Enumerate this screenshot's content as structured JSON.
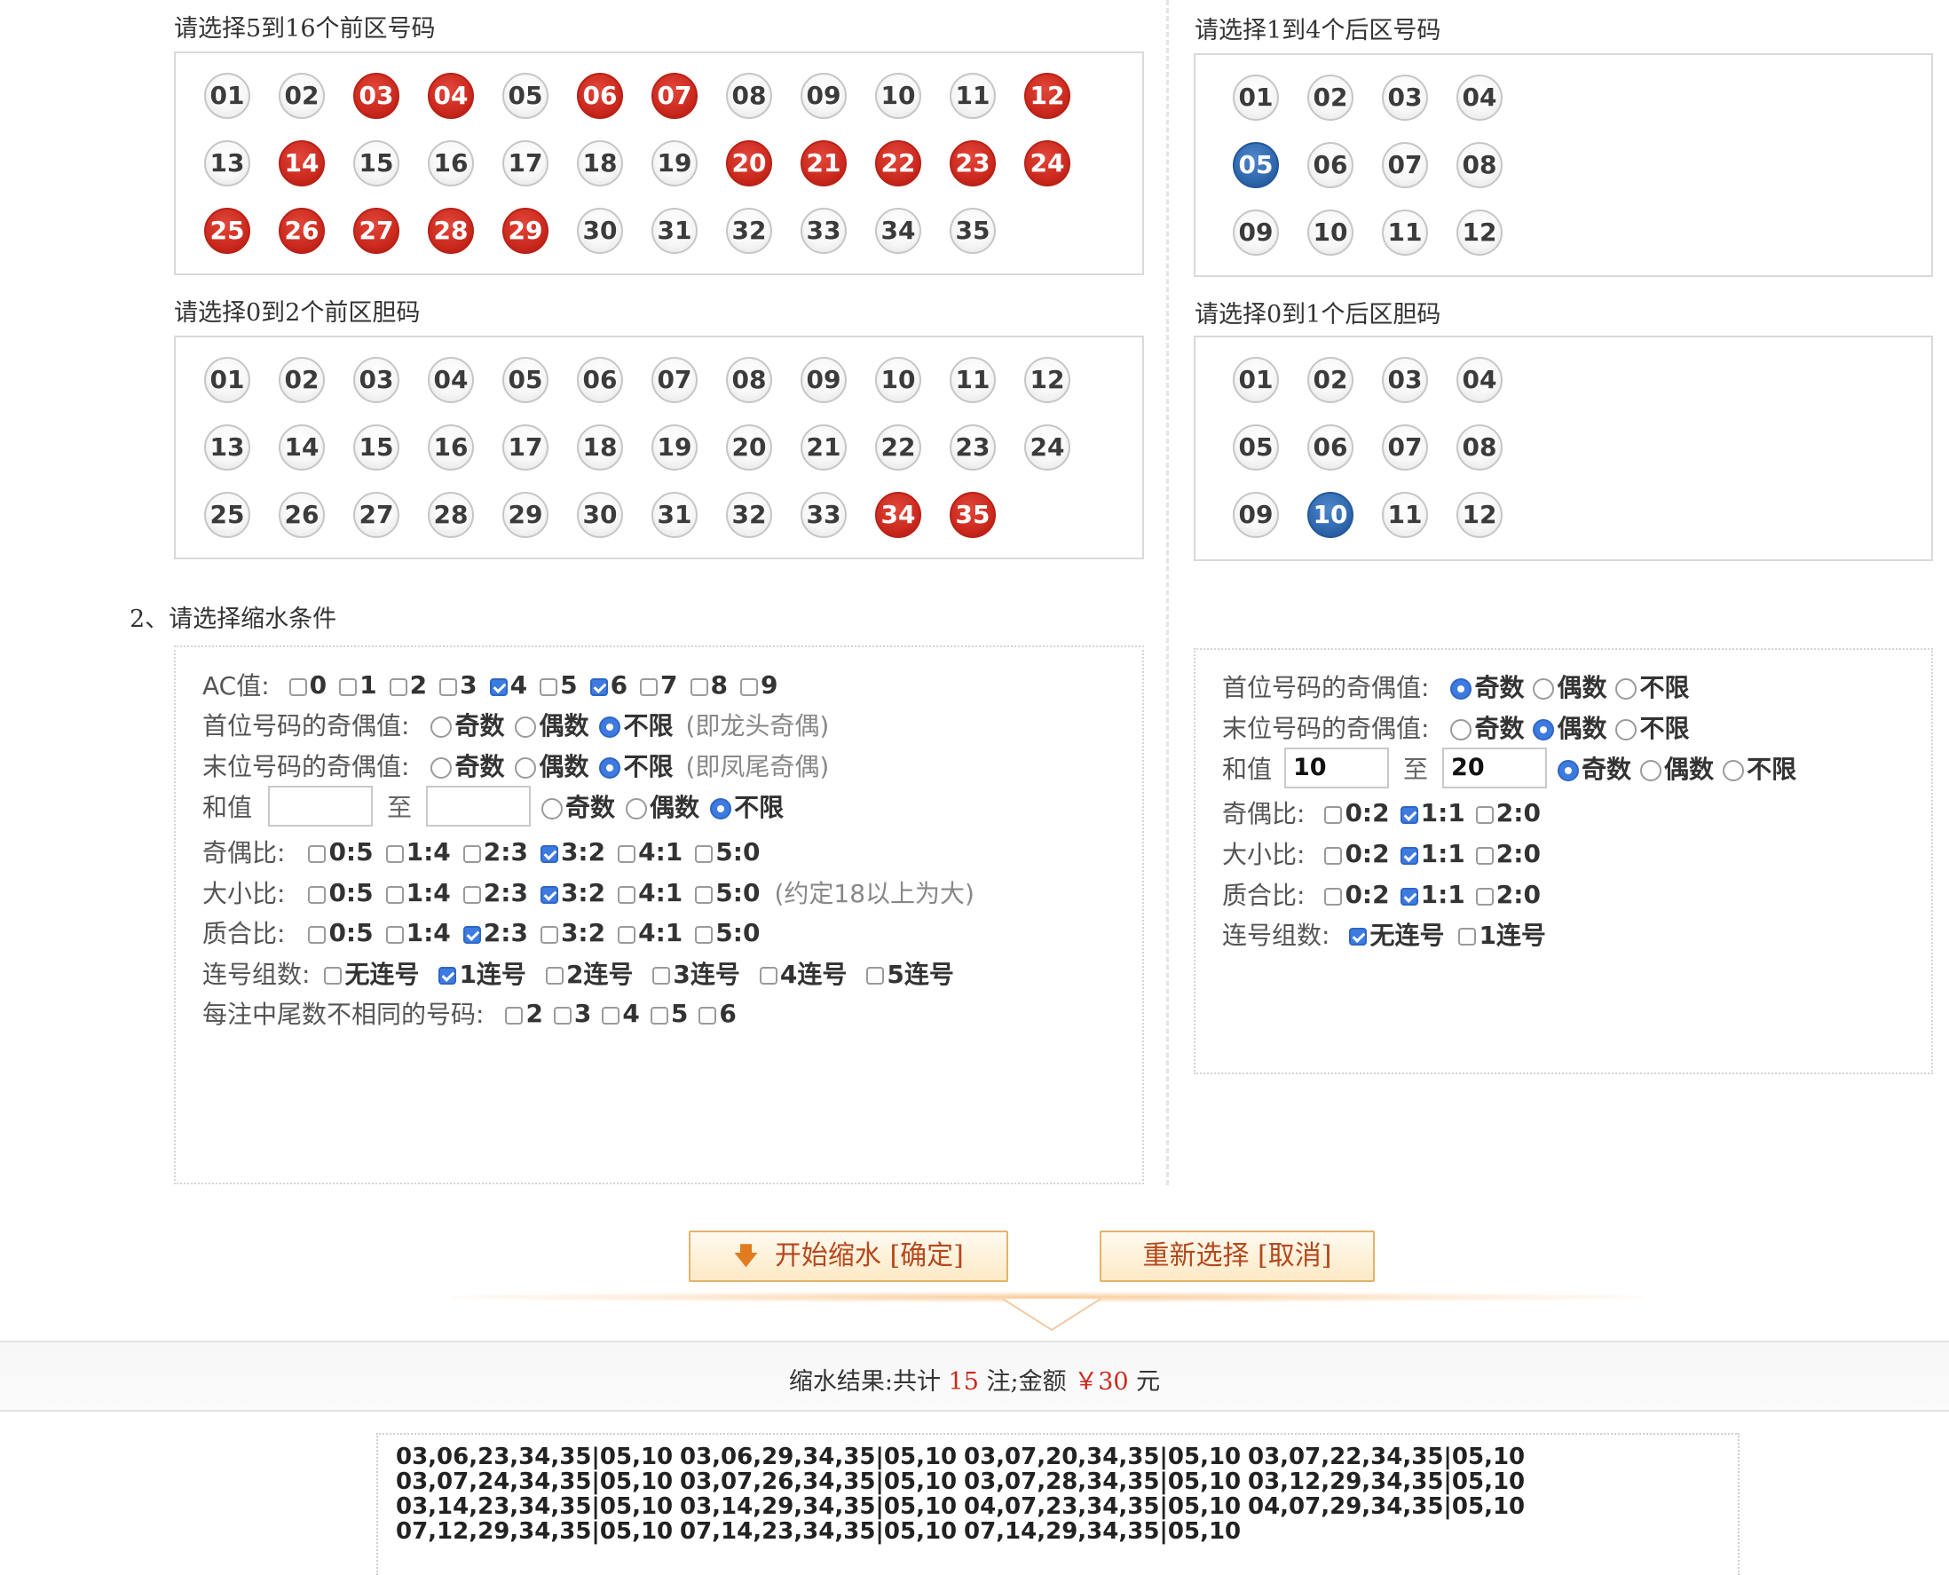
{
  "sections": {
    "front_main_label": "请选择5到16个前区号码",
    "back_main_label": "请选择1到4个后区号码",
    "front_dan_label": "请选择0到2个前区胆码",
    "back_dan_label": "请选择0到1个后区胆码",
    "conditions_label": "2、请选择缩水条件"
  },
  "front_main": [
    {
      "n": "01",
      "s": "off"
    },
    {
      "n": "02",
      "s": "off"
    },
    {
      "n": "03",
      "s": "red"
    },
    {
      "n": "04",
      "s": "red"
    },
    {
      "n": "05",
      "s": "off"
    },
    {
      "n": "06",
      "s": "red"
    },
    {
      "n": "07",
      "s": "red"
    },
    {
      "n": "08",
      "s": "off"
    },
    {
      "n": "09",
      "s": "off"
    },
    {
      "n": "10",
      "s": "off"
    },
    {
      "n": "11",
      "s": "off"
    },
    {
      "n": "12",
      "s": "red"
    },
    {
      "n": "13",
      "s": "off"
    },
    {
      "n": "14",
      "s": "red"
    },
    {
      "n": "15",
      "s": "off"
    },
    {
      "n": "16",
      "s": "off"
    },
    {
      "n": "17",
      "s": "off"
    },
    {
      "n": "18",
      "s": "off"
    },
    {
      "n": "19",
      "s": "off"
    },
    {
      "n": "20",
      "s": "red"
    },
    {
      "n": "21",
      "s": "red"
    },
    {
      "n": "22",
      "s": "red"
    },
    {
      "n": "23",
      "s": "red"
    },
    {
      "n": "24",
      "s": "red"
    },
    {
      "n": "25",
      "s": "red"
    },
    {
      "n": "26",
      "s": "red"
    },
    {
      "n": "27",
      "s": "red"
    },
    {
      "n": "28",
      "s": "red"
    },
    {
      "n": "29",
      "s": "red"
    },
    {
      "n": "30",
      "s": "off"
    },
    {
      "n": "31",
      "s": "off"
    },
    {
      "n": "32",
      "s": "off"
    },
    {
      "n": "33",
      "s": "off"
    },
    {
      "n": "34",
      "s": "off"
    },
    {
      "n": "35",
      "s": "off"
    }
  ],
  "front_dan": [
    {
      "n": "01",
      "s": "off"
    },
    {
      "n": "02",
      "s": "off"
    },
    {
      "n": "03",
      "s": "off"
    },
    {
      "n": "04",
      "s": "off"
    },
    {
      "n": "05",
      "s": "off"
    },
    {
      "n": "06",
      "s": "off"
    },
    {
      "n": "07",
      "s": "off"
    },
    {
      "n": "08",
      "s": "off"
    },
    {
      "n": "09",
      "s": "off"
    },
    {
      "n": "10",
      "s": "off"
    },
    {
      "n": "11",
      "s": "off"
    },
    {
      "n": "12",
      "s": "off"
    },
    {
      "n": "13",
      "s": "off"
    },
    {
      "n": "14",
      "s": "off"
    },
    {
      "n": "15",
      "s": "off"
    },
    {
      "n": "16",
      "s": "off"
    },
    {
      "n": "17",
      "s": "off"
    },
    {
      "n": "18",
      "s": "off"
    },
    {
      "n": "19",
      "s": "off"
    },
    {
      "n": "20",
      "s": "off"
    },
    {
      "n": "21",
      "s": "off"
    },
    {
      "n": "22",
      "s": "off"
    },
    {
      "n": "23",
      "s": "off"
    },
    {
      "n": "24",
      "s": "off"
    },
    {
      "n": "25",
      "s": "off"
    },
    {
      "n": "26",
      "s": "off"
    },
    {
      "n": "27",
      "s": "off"
    },
    {
      "n": "28",
      "s": "off"
    },
    {
      "n": "29",
      "s": "off"
    },
    {
      "n": "30",
      "s": "off"
    },
    {
      "n": "31",
      "s": "off"
    },
    {
      "n": "32",
      "s": "off"
    },
    {
      "n": "33",
      "s": "off"
    },
    {
      "n": "34",
      "s": "red"
    },
    {
      "n": "35",
      "s": "red"
    }
  ],
  "back_main": [
    {
      "n": "01",
      "s": "off"
    },
    {
      "n": "02",
      "s": "off"
    },
    {
      "n": "03",
      "s": "off"
    },
    {
      "n": "04",
      "s": "off"
    },
    {
      "n": "05",
      "s": "blue"
    },
    {
      "n": "06",
      "s": "off"
    },
    {
      "n": "07",
      "s": "off"
    },
    {
      "n": "08",
      "s": "off"
    },
    {
      "n": "09",
      "s": "off"
    },
    {
      "n": "10",
      "s": "off"
    },
    {
      "n": "11",
      "s": "off"
    },
    {
      "n": "12",
      "s": "off"
    }
  ],
  "back_dan": [
    {
      "n": "01",
      "s": "off"
    },
    {
      "n": "02",
      "s": "off"
    },
    {
      "n": "03",
      "s": "off"
    },
    {
      "n": "04",
      "s": "off"
    },
    {
      "n": "05",
      "s": "off"
    },
    {
      "n": "06",
      "s": "off"
    },
    {
      "n": "07",
      "s": "off"
    },
    {
      "n": "08",
      "s": "off"
    },
    {
      "n": "09",
      "s": "off"
    },
    {
      "n": "10",
      "s": "blue"
    },
    {
      "n": "11",
      "s": "off"
    },
    {
      "n": "12",
      "s": "off"
    }
  ],
  "front_conditions": {
    "ac": {
      "label": "AC值:",
      "options": [
        {
          "t": "0",
          "on": false
        },
        {
          "t": "1",
          "on": false
        },
        {
          "t": "2",
          "on": false
        },
        {
          "t": "3",
          "on": false
        },
        {
          "t": "4",
          "on": true
        },
        {
          "t": "5",
          "on": false
        },
        {
          "t": "6",
          "on": true
        },
        {
          "t": "7",
          "on": false
        },
        {
          "t": "8",
          "on": false
        },
        {
          "t": "9",
          "on": false
        }
      ]
    },
    "first_parity": {
      "label": "首位号码的奇偶值:",
      "options": [
        {
          "t": "奇数",
          "on": false
        },
        {
          "t": "偶数",
          "on": false
        },
        {
          "t": "不限",
          "on": true
        }
      ],
      "note": "(即龙头奇偶)"
    },
    "last_parity": {
      "label": "末位号码的奇偶值:",
      "options": [
        {
          "t": "奇数",
          "on": false
        },
        {
          "t": "偶数",
          "on": false
        },
        {
          "t": "不限",
          "on": true
        }
      ],
      "note": "(即凤尾奇偶)"
    },
    "sum": {
      "label": "和值",
      "from": "",
      "to_label": "至",
      "to": "",
      "options": [
        {
          "t": "奇数",
          "on": false
        },
        {
          "t": "偶数",
          "on": false
        },
        {
          "t": "不限",
          "on": true
        }
      ]
    },
    "odd_even": {
      "label": "奇偶比:",
      "options": [
        {
          "t": "0:5",
          "on": false
        },
        {
          "t": "1:4",
          "on": false
        },
        {
          "t": "2:3",
          "on": false
        },
        {
          "t": "3:2",
          "on": true
        },
        {
          "t": "4:1",
          "on": false
        },
        {
          "t": "5:0",
          "on": false
        }
      ]
    },
    "big_small": {
      "label": "大小比:",
      "options": [
        {
          "t": "0:5",
          "on": false
        },
        {
          "t": "1:4",
          "on": false
        },
        {
          "t": "2:3",
          "on": false
        },
        {
          "t": "3:2",
          "on": true
        },
        {
          "t": "4:1",
          "on": false
        },
        {
          "t": "5:0",
          "on": false
        }
      ],
      "note": "(约定18以上为大)"
    },
    "prime": {
      "label": "质合比:",
      "options": [
        {
          "t": "0:5",
          "on": false
        },
        {
          "t": "1:4",
          "on": false
        },
        {
          "t": "2:3",
          "on": true
        },
        {
          "t": "3:2",
          "on": false
        },
        {
          "t": "4:1",
          "on": false
        },
        {
          "t": "5:0",
          "on": false
        }
      ]
    },
    "consecutive": {
      "label": "连号组数:",
      "options": [
        {
          "t": "无连号",
          "on": false
        },
        {
          "t": "1连号",
          "on": true
        },
        {
          "t": "2连号",
          "on": false
        },
        {
          "t": "3连号",
          "on": false
        },
        {
          "t": "4连号",
          "on": false
        },
        {
          "t": "5连号",
          "on": false
        }
      ]
    },
    "tail": {
      "label": "每注中尾数不相同的号码:",
      "options": [
        {
          "t": "2",
          "on": false
        },
        {
          "t": "3",
          "on": false
        },
        {
          "t": "4",
          "on": false
        },
        {
          "t": "5",
          "on": false
        },
        {
          "t": "6",
          "on": false
        }
      ]
    }
  },
  "back_conditions": {
    "first_parity": {
      "label": "首位号码的奇偶值:",
      "options": [
        {
          "t": "奇数",
          "on": true
        },
        {
          "t": "偶数",
          "on": false
        },
        {
          "t": "不限",
          "on": false
        }
      ]
    },
    "last_parity": {
      "label": "末位号码的奇偶值:",
      "options": [
        {
          "t": "奇数",
          "on": false
        },
        {
          "t": "偶数",
          "on": true
        },
        {
          "t": "不限",
          "on": false
        }
      ]
    },
    "sum": {
      "label": "和值",
      "from": "10",
      "to_label": "至",
      "to": "20",
      "options": [
        {
          "t": "奇数",
          "on": true
        },
        {
          "t": "偶数",
          "on": false
        },
        {
          "t": "不限",
          "on": false
        }
      ]
    },
    "odd_even": {
      "label": "奇偶比:",
      "options": [
        {
          "t": "0:2",
          "on": false
        },
        {
          "t": "1:1",
          "on": true
        },
        {
          "t": "2:0",
          "on": false
        }
      ]
    },
    "big_small": {
      "label": "大小比:",
      "options": [
        {
          "t": "0:2",
          "on": false
        },
        {
          "t": "1:1",
          "on": true
        },
        {
          "t": "2:0",
          "on": false
        }
      ]
    },
    "prime": {
      "label": "质合比:",
      "options": [
        {
          "t": "0:2",
          "on": false
        },
        {
          "t": "1:1",
          "on": true
        },
        {
          "t": "2:0",
          "on": false
        }
      ]
    },
    "consecutive": {
      "label": "连号组数:",
      "options": [
        {
          "t": "无连号",
          "on": true
        },
        {
          "t": "1连号",
          "on": false
        }
      ]
    }
  },
  "buttons": {
    "start": "开始缩水 [确定]",
    "reset": "重新选择 [取消]"
  },
  "result": {
    "prefix": "缩水结果:共计",
    "count": "15",
    "mid": "注;金额",
    "amount": "￥30",
    "suffix": "元"
  },
  "results": [
    "03,06,23,34,35|05,10",
    "03,06,29,34,35|05,10",
    "03,07,20,34,35|05,10",
    "03,07,22,34,35|05,10",
    "03,07,24,34,35|05,10",
    "03,07,26,34,35|05,10",
    "03,07,28,34,35|05,10",
    "03,12,29,34,35|05,10",
    "03,14,23,34,35|05,10",
    "03,14,29,34,35|05,10",
    "04,07,23,34,35|05,10",
    "04,07,29,34,35|05,10",
    "07,12,29,34,35|05,10",
    "07,14,23,34,35|05,10",
    "07,14,29,34,35|05,10"
  ],
  "colors": {
    "selected_red": "#cc2a1e",
    "selected_blue": "#2f68ad",
    "checkbox_on": "#3d7be0",
    "result_count": "#cc2a1e",
    "button_text": "#b5481c"
  }
}
